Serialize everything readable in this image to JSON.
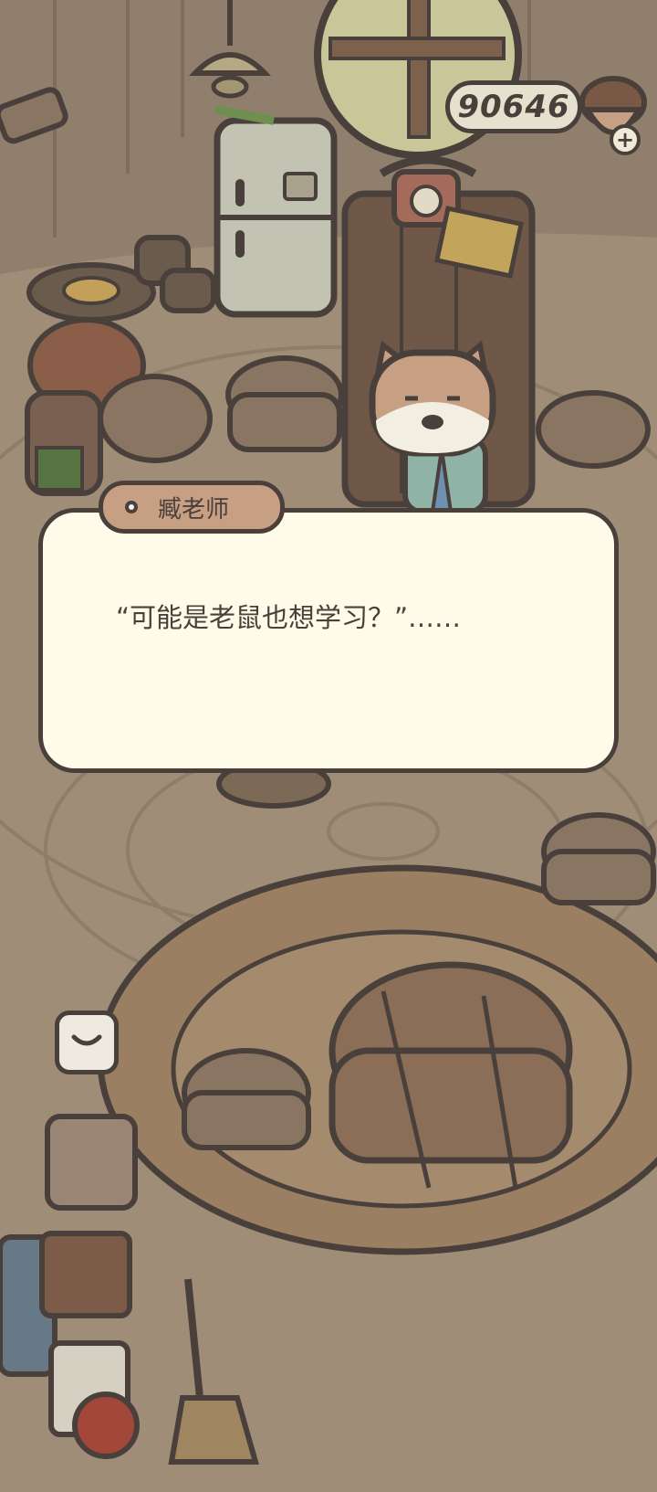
{
  "hud": {
    "currency_value": "90646",
    "add_button": "+"
  },
  "dialog": {
    "speaker": "臧老师",
    "text": "“可能是老鼠也想学习？”……"
  },
  "icons": {
    "currency": "acorn-icon",
    "collapse": "chevron-down-icon"
  }
}
